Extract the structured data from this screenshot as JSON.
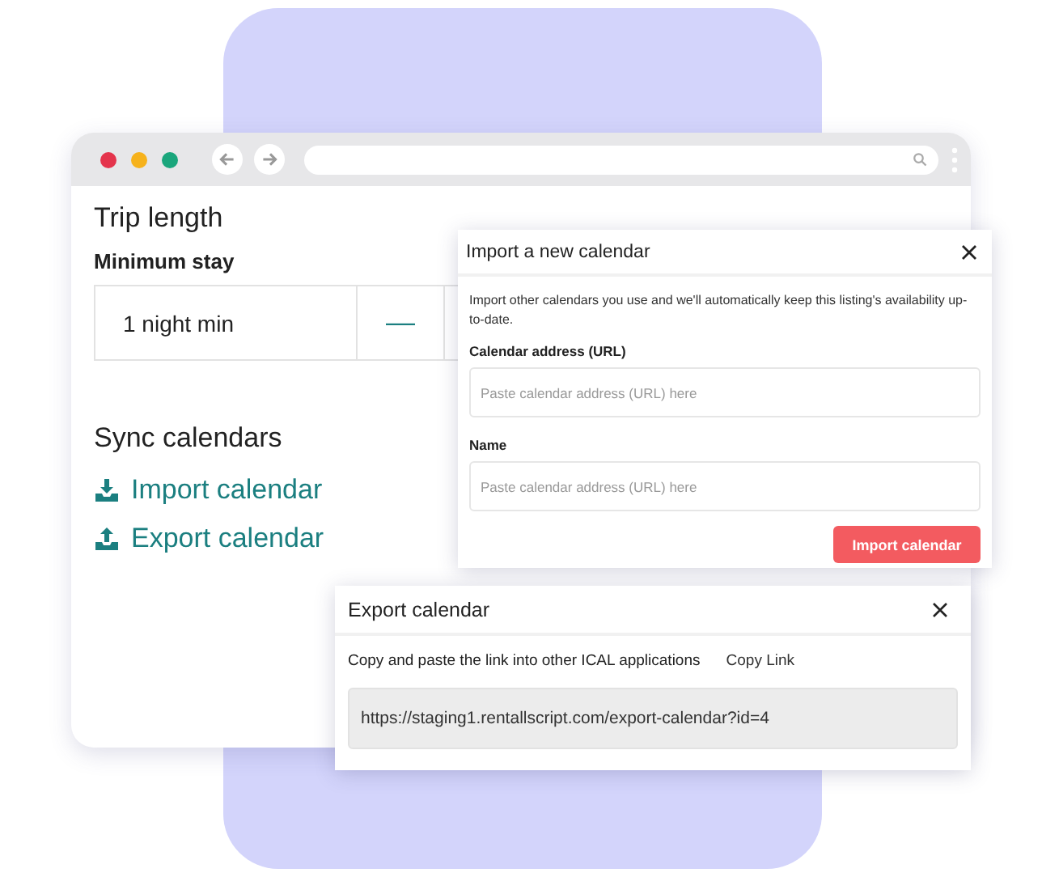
{
  "page": {
    "title": "Trip length",
    "minimum_stay": {
      "label": "Minimum stay",
      "value": "1 night min",
      "decrease": "—"
    },
    "sync_title": "Sync calendars",
    "links": [
      {
        "kind": "import",
        "label": "Import calendar"
      },
      {
        "kind": "export",
        "label": "Export calendar"
      }
    ]
  },
  "import_dialog": {
    "title": "Import a new calendar",
    "description": "Import other calendars you use and we'll automatically keep this listing's availability up-to-date.",
    "fields": [
      {
        "label": "Calendar address (URL)",
        "placeholder": "Paste calendar address (URL) here"
      },
      {
        "label": "Name",
        "placeholder": "Paste calendar address (URL) here"
      }
    ],
    "button": "Import calendar"
  },
  "export_dialog": {
    "title": "Export calendar",
    "description": "Copy and paste the link into other ICAL applications",
    "copy_link": "Copy Link",
    "url": "https://staging1.rentallscript.com/export-calendar?id=4"
  }
}
